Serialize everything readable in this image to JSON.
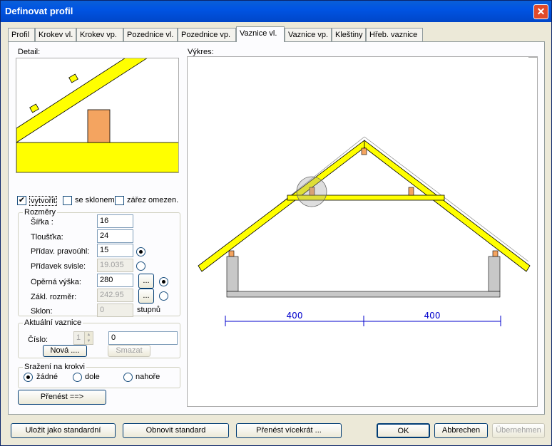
{
  "title": "Definovat profil",
  "tabs": [
    "Profil",
    "Krokev vl.",
    "Krokev vp.",
    "Pozednice vl.",
    "Pozednice vp.",
    "Vaznice vl.",
    "Vaznice vp.",
    "Kleštiny",
    "Hřeb. vaznice"
  ],
  "active_tab": "Vaznice vl.",
  "detail_label": "Detail:",
  "drawing_label": "Výkres:",
  "checks": {
    "vytvorit": "vytvořit",
    "se_sklonem": "se sklonem",
    "zarez": "zářez omezen."
  },
  "rozmery": {
    "title": "Rozměry",
    "sirka_label": "Šířka :",
    "sirka": "16",
    "tloustka_label": "Tloušťka:",
    "tloustka": "24",
    "pridav_pravouhl_label": "Přídav. pravoúhl:",
    "pridav_pravouhl": "15",
    "pridavek_svisle_label": "Přídavek svisle:",
    "pridavek_svisle": "19.035",
    "operna_vyska_label": "Opěrná výška:",
    "operna_vyska": "280",
    "zakl_rozmer_label": "Zákl. rozměr:",
    "zakl_rozmer": "242.95",
    "sklon_label": "Sklon:",
    "sklon": "0",
    "sklon_unit": "stupnů",
    "dots_button": "..."
  },
  "aktualni": {
    "title": "Aktuální vaznice",
    "cislo_label": "Číslo:",
    "cislo": "1",
    "name": "0",
    "nova": "Nová ....",
    "smazat": "Smazat"
  },
  "srazeni": {
    "title": "Sražení na krokvi",
    "options": [
      "žádné",
      "dole",
      "nahoře"
    ]
  },
  "prenest": "Přenést ==>",
  "dimensions": [
    "400",
    "400"
  ],
  "footer": {
    "ulozit": "Uložit jako standardní",
    "obnovit": "Obnovit standard",
    "prenest_vicekrat": "Přenést vícekrát ...",
    "ok": "OK",
    "abbrechen": "Abbrechen",
    "ubernehmen": "Übernehmen"
  },
  "colors": {
    "timber": "#ffff00",
    "purlin": "#f4a460",
    "dimension": "#0000cc"
  }
}
